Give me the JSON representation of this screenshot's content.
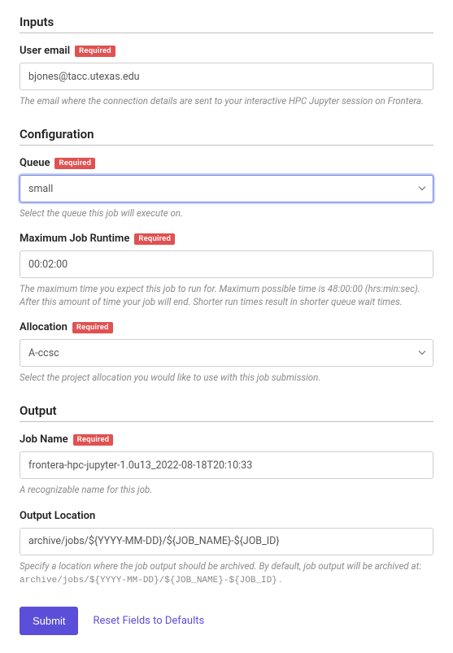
{
  "sections": {
    "inputs": {
      "title": "Inputs"
    },
    "configuration": {
      "title": "Configuration"
    },
    "output": {
      "title": "Output"
    }
  },
  "badges": {
    "required": "Required"
  },
  "fields": {
    "user_email": {
      "label": "User email",
      "value": "bjones@tacc.utexas.edu",
      "help": "The email where the connection details are sent to your interactive HPC Jupyter session on Frontera."
    },
    "queue": {
      "label": "Queue",
      "selected": "small",
      "help": "Select the queue this job will execute on."
    },
    "max_runtime": {
      "label": "Maximum Job Runtime",
      "value": "00:02:00",
      "help": "The maximum time you expect this job to run for. Maximum possible time is 48:00:00 (hrs:min:sec). After this amount of time your job will end. Shorter run times result in shorter queue wait times."
    },
    "allocation": {
      "label": "Allocation",
      "selected": "A-ccsc",
      "help": "Select the project allocation you would like to use with this job submission."
    },
    "job_name": {
      "label": "Job Name",
      "value": "frontera-hpc-jupyter-1.0u13_2022-08-18T20:10:33",
      "help": "A recognizable name for this job."
    },
    "output_location": {
      "label": "Output Location",
      "value": "archive/jobs/${YYYY-MM-DD}/${JOB_NAME}-${JOB_ID}",
      "help_prefix": "Specify a location where the job output should be archived. By default, job output will be archived at: ",
      "help_code": "archive/jobs/${YYYY-MM-DD}/${JOB_NAME}-${JOB_ID}",
      "help_suffix": " ."
    }
  },
  "actions": {
    "submit": "Submit",
    "reset": "Reset Fields to Defaults"
  }
}
